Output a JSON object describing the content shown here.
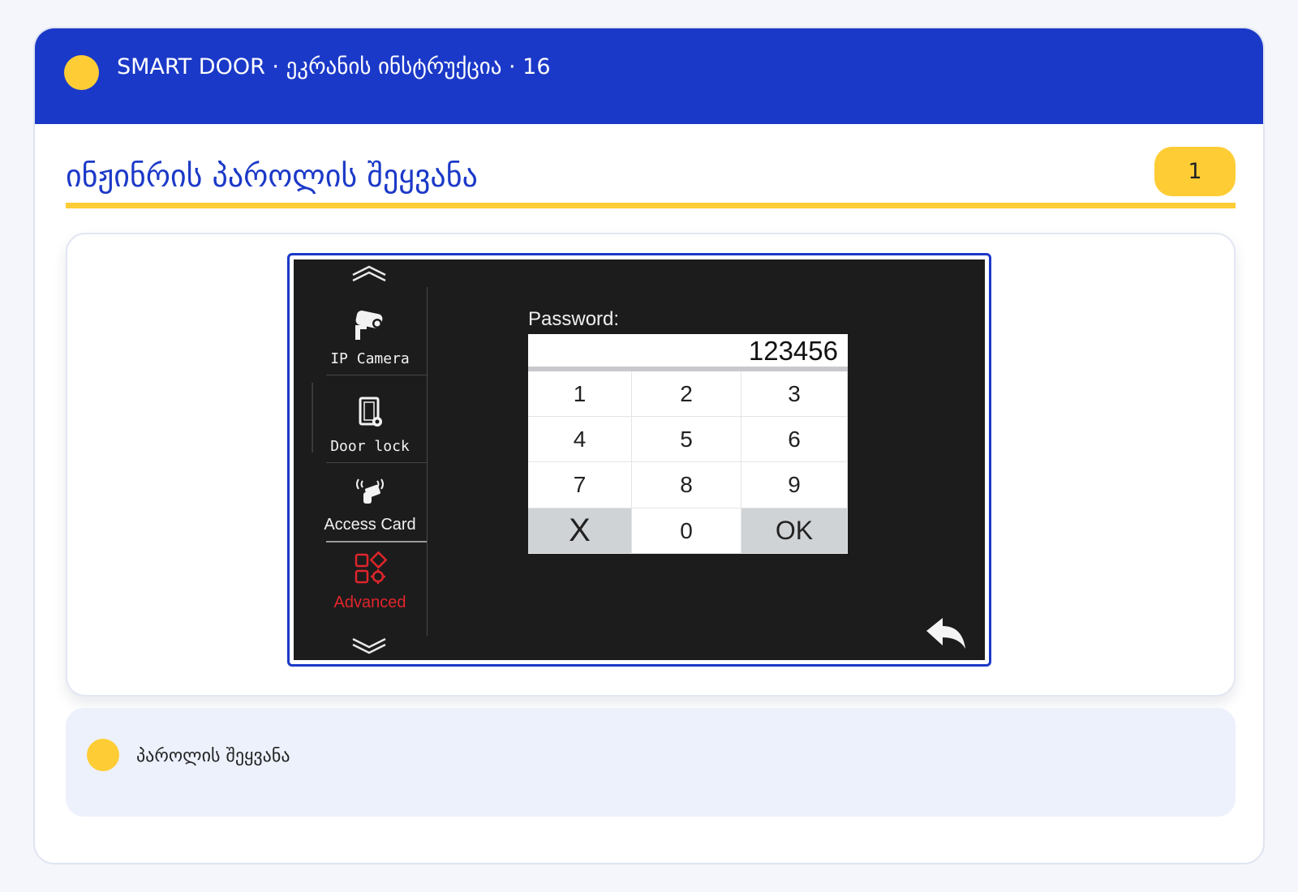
{
  "header": {
    "title": "SMART DOOR · ეკრანის ინსტრუქცია · 16"
  },
  "section": {
    "title": "ინჟინრის პაროლის შეყვანა",
    "step": "1"
  },
  "device_screen": {
    "sidebar": {
      "items": [
        {
          "label": "IP Camera",
          "icon": "ip-camera-icon"
        },
        {
          "label": "Door lock",
          "icon": "door-lock-icon"
        },
        {
          "label": "Access Card",
          "icon": "access-card-icon"
        },
        {
          "label": "Advanced",
          "icon": "advanced-icon",
          "active": true
        }
      ],
      "scroll_up_icon": "chevron-up-icon",
      "scroll_down_icon": "chevron-down-icon"
    },
    "password_label": "Password:",
    "password_value": "123456",
    "keypad": {
      "k1": "1",
      "k2": "2",
      "k3": "3",
      "k4": "4",
      "k5": "5",
      "k6": "6",
      "k7": "7",
      "k8": "8",
      "k9": "9",
      "clear": "X",
      "k0": "0",
      "ok": "OK"
    },
    "back_icon": "back-arrow-icon"
  },
  "note": {
    "text": "პაროლის შეყვანა"
  },
  "colors": {
    "brand_blue": "#1b39c8",
    "accent_yellow": "#fecd36",
    "active_red": "#e0252b"
  }
}
